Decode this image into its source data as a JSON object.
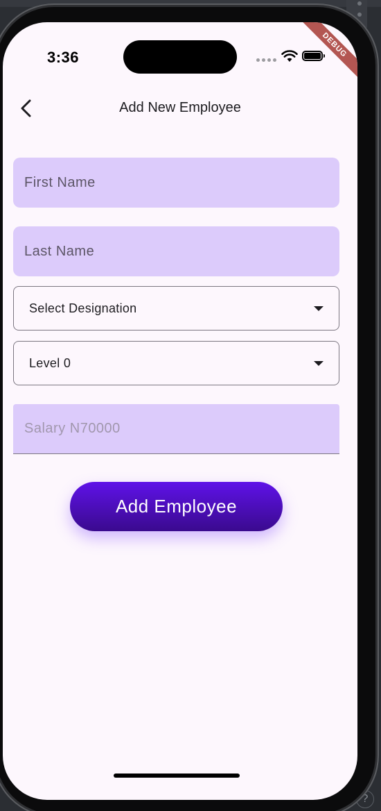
{
  "status_bar": {
    "time": "3:36",
    "debug_banner": "DEBUG",
    "icons": [
      "cellular-dots-icon",
      "wifi-icon",
      "battery-icon"
    ]
  },
  "app_bar": {
    "back_icon": "chevron-left-icon",
    "title": "Add New Employee"
  },
  "form": {
    "first_name": {
      "placeholder": "First Name",
      "value": ""
    },
    "last_name": {
      "placeholder": "Last Name",
      "value": ""
    },
    "designation": {
      "selected": "Select Designation",
      "icon": "dropdown-arrow-icon"
    },
    "level": {
      "selected": "Level 0",
      "icon": "dropdown-arrow-icon"
    },
    "salary": {
      "placeholder": "Salary N70000",
      "value": ""
    }
  },
  "actions": {
    "add_label": "Add Employee"
  },
  "colors": {
    "field_fill": "#dccbfb",
    "screen_bg": "#fdf7fd",
    "button_gradient_top": "#5f12e8",
    "button_gradient_bottom": "#3a0a8e",
    "debug_ribbon": "#b35652"
  }
}
